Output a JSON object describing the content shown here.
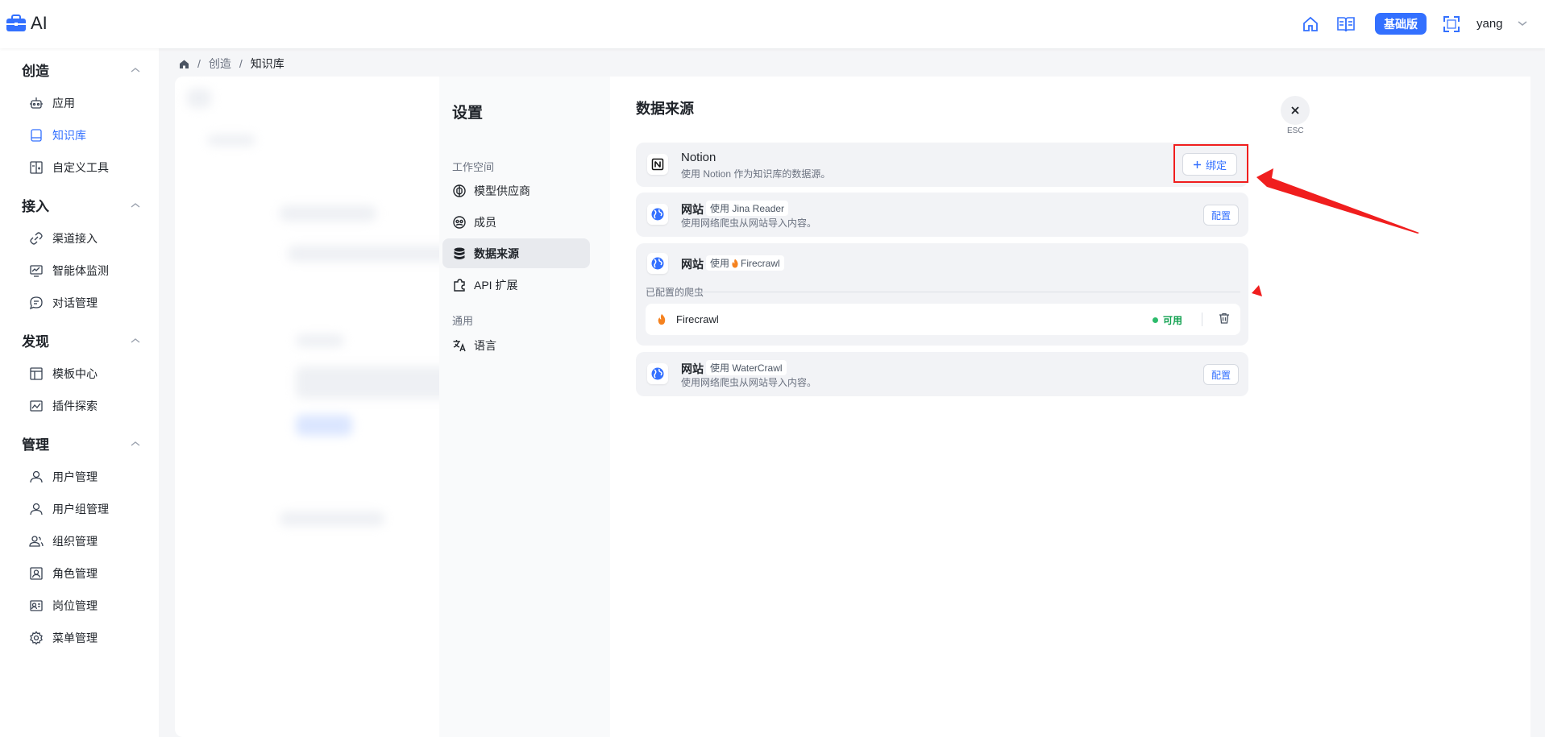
{
  "header": {
    "logo_text": "AI",
    "edition_badge": "基础版",
    "user_name": "yang"
  },
  "sidebar": {
    "sections": [
      {
        "title": "创造",
        "items": [
          {
            "label": "应用",
            "icon": "robot-icon"
          },
          {
            "label": "知识库",
            "icon": "book-icon",
            "active": true
          },
          {
            "label": "自定义工具",
            "icon": "tool-icon"
          }
        ]
      },
      {
        "title": "接入",
        "items": [
          {
            "label": "渠道接入",
            "icon": "link-icon"
          },
          {
            "label": "智能体监测",
            "icon": "monitor-icon"
          },
          {
            "label": "对话管理",
            "icon": "chat-icon"
          }
        ]
      },
      {
        "title": "发现",
        "items": [
          {
            "label": "模板中心",
            "icon": "template-icon"
          },
          {
            "label": "插件探索",
            "icon": "plugin-icon"
          }
        ]
      },
      {
        "title": "管理",
        "items": [
          {
            "label": "用户管理",
            "icon": "user-icon"
          },
          {
            "label": "用户组管理",
            "icon": "user-group-icon"
          },
          {
            "label": "组织管理",
            "icon": "org-icon"
          },
          {
            "label": "角色管理",
            "icon": "role-icon"
          },
          {
            "label": "岗位管理",
            "icon": "position-icon"
          },
          {
            "label": "菜单管理",
            "icon": "menu-settings-icon"
          }
        ]
      }
    ]
  },
  "breadcrumb": {
    "items": [
      "创造",
      "知识库"
    ]
  },
  "settings": {
    "title": "设置",
    "workspace_label": "工作空间",
    "general_label": "通用",
    "items": [
      {
        "label": "模型供应商",
        "icon": "brain-icon"
      },
      {
        "label": "成员",
        "icon": "members-icon"
      },
      {
        "label": "数据来源",
        "icon": "database-icon",
        "active": true
      },
      {
        "label": "API 扩展",
        "icon": "puzzle-icon"
      },
      {
        "label": "语言",
        "icon": "translate-icon"
      }
    ]
  },
  "content": {
    "title": "数据来源",
    "esc_label": "ESC",
    "notion": {
      "name": "Notion",
      "desc": "使用 Notion 作为知识库的数据源。",
      "bind_label": "绑定"
    },
    "jina": {
      "name": "网站",
      "tag": "使用 Jina Reader",
      "desc": "使用网络爬虫从网站导入内容。",
      "config_label": "配置"
    },
    "firecrawl": {
      "name": "网站",
      "tag_prefix": "使用",
      "tag_name": "Firecrawl",
      "configured_label": "已配置的爬虫",
      "crawler_name": "Firecrawl",
      "status": "可用"
    },
    "watercrawl": {
      "name": "网站",
      "tag": "使用 WaterCrawl",
      "desc": "使用网络爬虫从网站导入内容。",
      "config_label": "配置"
    }
  },
  "colors": {
    "accent": "#3370ff",
    "annotation_red": "#f01e1e",
    "status_green": "#12a150"
  }
}
